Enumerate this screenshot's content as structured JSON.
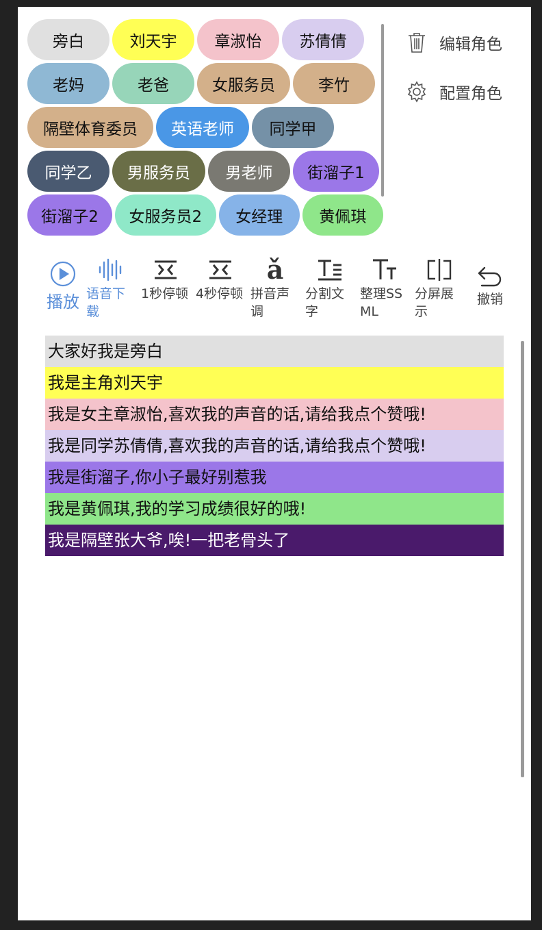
{
  "roles": {
    "rows": [
      [
        {
          "label": "旁白",
          "color": "#e0e0e0"
        },
        {
          "label": "刘天宇",
          "color": "#ffff55"
        },
        {
          "label": "章淑怡",
          "color": "#f4c3cb"
        },
        {
          "label": "苏倩倩",
          "color": "#d8cdef"
        }
      ],
      [
        {
          "label": "老妈",
          "color": "#8fb8d4"
        },
        {
          "label": "老爸",
          "color": "#97d5b9"
        },
        {
          "label": "女服务员",
          "color": "#d3b08a"
        },
        {
          "label": "李竹",
          "color": "#d3b08a"
        }
      ],
      [
        {
          "label": "隔壁体育委员",
          "color": "#d3b08a"
        },
        {
          "label": "英语老师",
          "color": "#4a97e6",
          "light": true
        },
        {
          "label": "同学甲",
          "color": "#7591a7"
        }
      ],
      [
        {
          "label": "同学乙",
          "color": "#4a5a71",
          "light": true
        },
        {
          "label": "男服务员",
          "color": "#6a6e47",
          "light": true
        },
        {
          "label": "男老师",
          "color": "#7a7972",
          "light": true
        },
        {
          "label": "街溜子1",
          "color": "#9b77e8"
        }
      ],
      [
        {
          "label": "街溜子2",
          "color": "#9b77e8"
        },
        {
          "label": "女服务员2",
          "color": "#8fe8c8"
        },
        {
          "label": "女经理",
          "color": "#86b3e8"
        },
        {
          "label": "黄佩琪",
          "color": "#8fe68a"
        }
      ]
    ]
  },
  "side_actions": {
    "edit_role": "编辑角色",
    "config_role": "配置角色"
  },
  "toolbar": {
    "play": "播放",
    "voice_download": "语音下载",
    "pause_1s": "1秒停顿",
    "pause_4s": "4秒停顿",
    "pinyin_tone": "拼音声调",
    "split_text": "分割文字",
    "organize_ssml": "整理SSML",
    "split_screen": "分屏展示",
    "undo": "撤销",
    "pinyin_glyph": "ǎ",
    "accent_color": "#5b8fd9"
  },
  "lines": [
    {
      "text": "大家好我是旁白",
      "color": "#e0e0e0"
    },
    {
      "text": "我是主角刘天宇",
      "color": "#ffff55"
    },
    {
      "text": "我是女主章淑怡,喜欢我的声音的话,请给我点个赞哦!",
      "color": "#f4c3cb"
    },
    {
      "text": "我是同学苏倩倩,喜欢我的声音的话,请给我点个赞哦!",
      "color": "#d8cdef"
    },
    {
      "text": "我是街溜子,你小子最好别惹我",
      "color": "#9b77e8"
    },
    {
      "text": "我是黄佩琪,我的学习成绩很好的哦!",
      "color": "#8fe68a"
    },
    {
      "text": "我是隔壁张大爷,唉!一把老骨头了",
      "color": "#4a1a6b",
      "light": true
    }
  ]
}
